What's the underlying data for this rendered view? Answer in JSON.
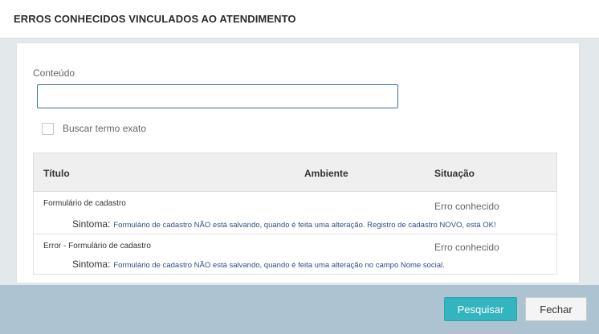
{
  "header": {
    "title": "ERROS CONHECIDOS VINCULADOS AO ATENDIMENTO"
  },
  "form": {
    "content_label": "Conteúdo",
    "content_value": "",
    "exact_term_label": "Buscar termo exato",
    "exact_term_checked": false
  },
  "grid": {
    "columns": [
      "Título",
      "Ambiente",
      "Situação"
    ],
    "sintoma_label": "Sintoma:",
    "rows": [
      {
        "title": "Formulário de cadastro",
        "ambiente": "",
        "situacao": "Erro conhecido",
        "sintoma": "Formulário de cadastro NÃO está salvando, quando é feita uma alteração. Registro de cadastro NOVO, está OK!"
      },
      {
        "title": "Error - Formulário de cadastro",
        "ambiente": "",
        "situacao": "Erro conhecido",
        "sintoma": "Formulário de cadastro NÃO está salvando, quando é feita uma alteração no campo Nome social."
      }
    ]
  },
  "footer": {
    "search_label": "Pesquisar",
    "close_label": "Fechar"
  },
  "colors": {
    "accent": "#33b5bf",
    "footer_bg": "#aec3d1",
    "input_border": "#3f6f8f",
    "sintoma_text": "#2e4f86"
  }
}
